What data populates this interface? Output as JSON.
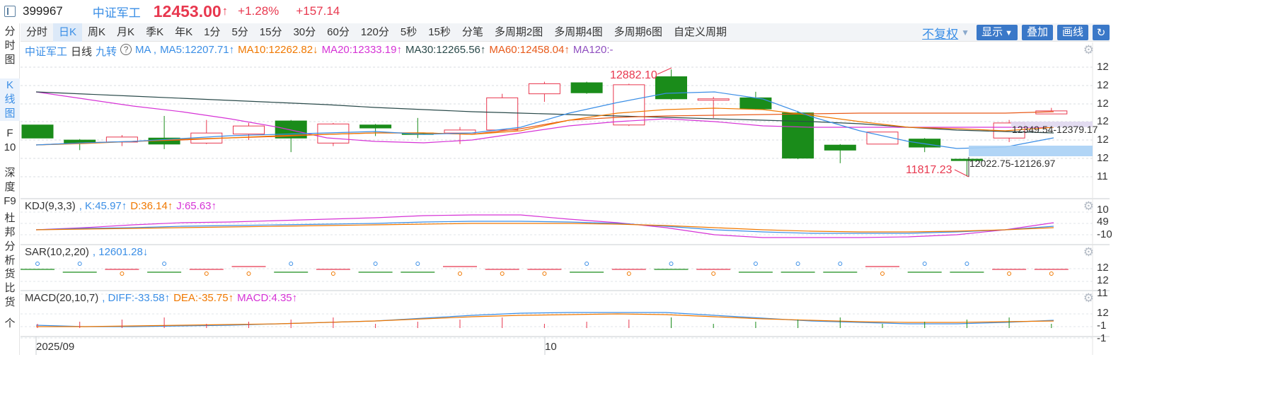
{
  "header": {
    "code": "399967",
    "name": "中证军工",
    "price": "12453.00",
    "arrow": "↑",
    "change_pct": "+1.28%",
    "change_val": "+157.14"
  },
  "left_nav": [
    {
      "label": "分时图",
      "chars": [
        "分",
        "时",
        "图"
      ]
    },
    {
      "label": "K线图",
      "chars": [
        "K",
        "线",
        "图"
      ]
    },
    {
      "label": "F10",
      "chars": [
        "F",
        "10"
      ]
    },
    {
      "label": "深度F9",
      "chars": [
        "深",
        "度",
        "F9"
      ]
    },
    {
      "label": "杜邦分析",
      "chars": [
        "杜",
        "邦",
        "分",
        "析"
      ]
    },
    {
      "label": "货比货",
      "chars": [
        "货",
        "比",
        "货"
      ]
    },
    {
      "label": "个",
      "chars": [
        "个"
      ]
    }
  ],
  "toolbar": {
    "periods": [
      "分时",
      "日K",
      "周K",
      "月K",
      "季K",
      "年K",
      "1分",
      "5分",
      "15分",
      "30分",
      "60分",
      "120分",
      "5秒",
      "15秒",
      "分笔",
      "多周期2图",
      "多周期4图",
      "多周期6图",
      "自定义周期"
    ],
    "active": "日K",
    "fq": "不复权",
    "display": "显示",
    "overlay": "叠加",
    "draw": "画线",
    "refresh_icon": "refresh-icon"
  },
  "main_legend": {
    "name": "中证军工",
    "period": "日线",
    "jiuzhuan": "九转",
    "help": "?",
    "ma_label": "MA ,",
    "ma5": "MA5:12207.71↑",
    "ma10": "MA10:12262.82↓",
    "ma20": "MA20:12333.19↑",
    "ma30": "MA30:12265.56↑",
    "ma60": "MA60:12458.04↑",
    "ma120": "MA120:-"
  },
  "annotations": {
    "high": "12882.10",
    "low": "11817.23",
    "range1": "12349.54-12379.17",
    "range2": "12022.75-12126.97"
  },
  "kdj_legend": {
    "name": "KDJ(9,3,3)",
    "k": ", K:45.97↑",
    "d": "D:36.14↑",
    "j": "J:65.63↑"
  },
  "sar_legend": {
    "name": "SAR(10,2,20)",
    "val": ", 12601.28↓"
  },
  "macd_legend": {
    "name": "MACD(20,10,7)",
    "diff": ", DIFF:-33.58↑",
    "dea": "DEA:-35.75↑",
    "macd": "MACD:4.35↑"
  },
  "right_axis": {
    "main": [
      "12",
      "12",
      "12",
      "12",
      "12",
      "12",
      "11"
    ],
    "kdj": [
      "10",
      "49",
      "-10"
    ],
    "sar": [
      "12",
      "12",
      "11"
    ],
    "macd": [
      "12",
      "-1",
      "-1"
    ]
  },
  "x_axis": {
    "start": "2025/09",
    "mid": "10"
  },
  "colors": {
    "up": "#e8384f",
    "down": "#1a8c1a",
    "ma5": "#3a8ee6",
    "ma10": "#f07800",
    "ma20": "#d633d6",
    "ma30": "#2a4a4a",
    "ma60": "#e85a1a",
    "ma120": "#9050c0"
  },
  "chart_data": {
    "type": "candlestick",
    "candles": [
      {
        "o": 12330,
        "c": 12200,
        "h": 12330,
        "l": 12200,
        "dir": "down"
      },
      {
        "o": 12180,
        "c": 12150,
        "h": 12190,
        "l": 12080,
        "dir": "down"
      },
      {
        "o": 12160,
        "c": 12210,
        "h": 12230,
        "l": 12120,
        "dir": "up"
      },
      {
        "o": 12200,
        "c": 12140,
        "h": 12420,
        "l": 12090,
        "dir": "down"
      },
      {
        "o": 12150,
        "c": 12250,
        "h": 12380,
        "l": 12140,
        "dir": "up"
      },
      {
        "o": 12240,
        "c": 12320,
        "h": 12350,
        "l": 12180,
        "dir": "up"
      },
      {
        "o": 12370,
        "c": 12200,
        "h": 12380,
        "l": 12060,
        "dir": "down"
      },
      {
        "o": 12150,
        "c": 12340,
        "h": 12350,
        "l": 12120,
        "dir": "up"
      },
      {
        "o": 12330,
        "c": 12300,
        "h": 12340,
        "l": 12220,
        "dir": "down"
      },
      {
        "o": 12250,
        "c": 12240,
        "h": 12400,
        "l": 12200,
        "dir": "down"
      },
      {
        "o": 12250,
        "c": 12280,
        "h": 12310,
        "l": 12140,
        "dir": "up"
      },
      {
        "o": 12280,
        "c": 12600,
        "h": 12640,
        "l": 12280,
        "dir": "up"
      },
      {
        "o": 12640,
        "c": 12740,
        "h": 12760,
        "l": 12560,
        "dir": "up"
      },
      {
        "o": 12750,
        "c": 12650,
        "h": 12760,
        "l": 12640,
        "dir": "down"
      },
      {
        "o": 12330,
        "c": 12730,
        "h": 12740,
        "l": 12320,
        "dir": "up"
      },
      {
        "o": 12810,
        "c": 12590,
        "h": 12882.1,
        "l": 12580,
        "dir": "down"
      },
      {
        "o": 12590,
        "c": 12580,
        "h": 12610,
        "l": 12400,
        "dir": "up"
      },
      {
        "o": 12600,
        "c": 12490,
        "h": 12660,
        "l": 12480,
        "dir": "down"
      },
      {
        "o": 12450,
        "c": 12000,
        "h": 12470,
        "l": 11990,
        "dir": "down"
      },
      {
        "o": 12130,
        "c": 12080,
        "h": 12140,
        "l": 11950,
        "dir": "down"
      },
      {
        "o": 12140,
        "c": 12260,
        "h": 12260,
        "l": 12140,
        "dir": "up"
      },
      {
        "o": 12190,
        "c": 12110,
        "h": 12200,
        "l": 12060,
        "dir": "down"
      },
      {
        "o": 11990,
        "c": 11990,
        "h": 11990,
        "l": 11817.23,
        "dir": "down"
      },
      {
        "o": 12200,
        "c": 12350,
        "h": 12380,
        "l": 12160,
        "dir": "up"
      },
      {
        "o": 12440,
        "c": 12470,
        "h": 12500,
        "l": 12440,
        "dir": "up"
      }
    ],
    "ylim": [
      11780,
      12940
    ]
  }
}
